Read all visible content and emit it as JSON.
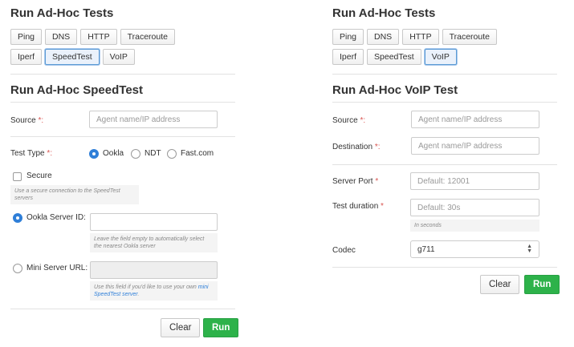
{
  "tests_title": "Run Ad-Hoc Tests",
  "test_buttons_row1": [
    "Ping",
    "DNS",
    "HTTP",
    "Traceroute"
  ],
  "test_buttons_row2": [
    "Iperf",
    "SpeedTest",
    "VoIP"
  ],
  "speedtest": {
    "title": "Run Ad-Hoc SpeedTest",
    "source_label": "Source",
    "source_placeholder": "Agent name/IP address",
    "test_type_label": "Test Type",
    "options": [
      "Ookla",
      "NDT",
      "Fast.com"
    ],
    "selected_option": "Ookla",
    "secure_label": "Secure",
    "secure_help": "Use a secure connection to the SpeedTest servers",
    "ookla_server_label": "Ookla Server ID:",
    "ookla_server_help": "Leave the field empty to automatically select the nearest Ookla server",
    "mini_server_label": "Mini Server URL:",
    "mini_server_help_prefix": "Use this field if you'd like to use your own",
    "mini_server_help_link": "mini SpeedTest server",
    "mini_server_help_suffix": ".",
    "clear_label": "Clear",
    "run_label": "Run"
  },
  "voip": {
    "title": "Run Ad-Hoc VoIP Test",
    "source_label": "Source",
    "source_placeholder": "Agent name/IP address",
    "destination_label": "Destination",
    "destination_placeholder": "Agent name/IP address",
    "server_port_label": "Server Port",
    "server_port_placeholder": "Default: 12001",
    "duration_label": "Test duration",
    "duration_placeholder": "Default: 30s",
    "duration_help": "In seconds",
    "codec_label": "Codec",
    "codec_value": "g711",
    "clear_label": "Clear",
    "run_label": "Run"
  },
  "required_marker": "*",
  "colon": ":",
  "colors": {
    "accent": "#2f7fd8",
    "run_green": "#2db24a",
    "required_red": "#d9534f"
  }
}
